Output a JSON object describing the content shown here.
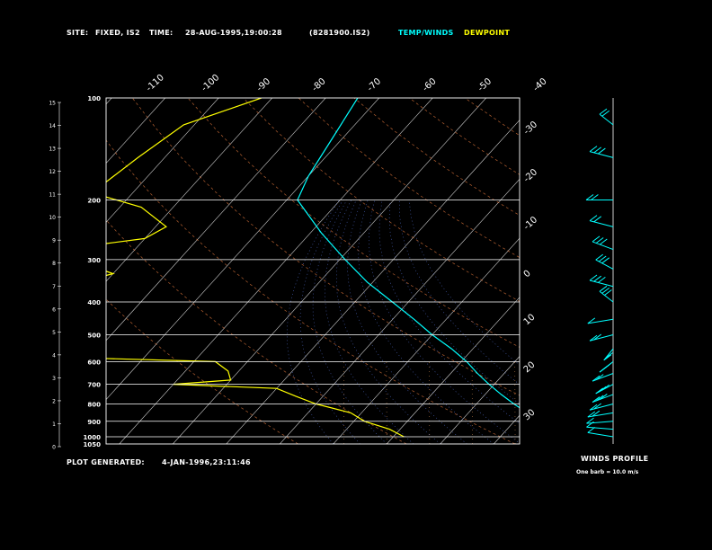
{
  "header": {
    "site_label": "SITE:",
    "site_value": "FIXED, IS2",
    "time_label": "TIME:",
    "time_value": "28-AUG-1995,19:00:28",
    "file_value": "(8281900.IS2)",
    "temp_legend": "TEMP/WINDS",
    "dew_legend": "DEWPOINT"
  },
  "footer": {
    "plot_generated_label": "PLOT GENERATED:",
    "plot_generated_value": "4-JAN-1996,23:11:46",
    "winds_profile_label": "WINDS PROFILE",
    "barb_note": "One barb = 10.0 m/s"
  },
  "colors": {
    "temperature": "#00ffff",
    "dewpoint": "#ffff00",
    "isobar": "#ffffff",
    "isotherm": "#ffffff",
    "dry_adiabat": "#ff8844",
    "moist_adiabat": "#6688ff",
    "mixing_ratio": "#ffaa66"
  },
  "chart_data": {
    "type": "line",
    "pressure_labels": [
      "100",
      "200",
      "300",
      "400",
      "500",
      "600",
      "700",
      "800",
      "900",
      "1000",
      "1050"
    ],
    "pressure_levels": [
      100,
      200,
      300,
      400,
      500,
      600,
      700,
      800,
      900,
      1000,
      1050
    ],
    "height_labels": [
      "15",
      "14",
      "13",
      "12",
      "11",
      "10",
      "9",
      "8",
      "7",
      "6",
      "5",
      "4",
      "3",
      "2",
      "1",
      "0"
    ],
    "top_temp_labels": [
      "-110",
      "-100",
      "-90",
      "-80",
      "-70",
      "-60",
      "-50",
      "-40"
    ],
    "right_temp_labels": [
      "-30",
      "-20",
      "-10",
      "0",
      "10",
      "20",
      "30"
    ],
    "series": [
      {
        "name": "TEMP/WINDS",
        "points": [
          {
            "p": 100,
            "t": -74
          },
          {
            "p": 130,
            "t": -72
          },
          {
            "p": 170,
            "t": -70
          },
          {
            "p": 200,
            "t": -68
          },
          {
            "p": 250,
            "t": -58
          },
          {
            "p": 300,
            "t": -49
          },
          {
            "p": 350,
            "t": -41
          },
          {
            "p": 400,
            "t": -33
          },
          {
            "p": 450,
            "t": -26
          },
          {
            "p": 500,
            "t": -20
          },
          {
            "p": 550,
            "t": -14
          },
          {
            "p": 600,
            "t": -9
          },
          {
            "p": 650,
            "t": -5
          },
          {
            "p": 700,
            "t": -1
          },
          {
            "p": 750,
            "t": 3
          },
          {
            "p": 800,
            "t": 7
          },
          {
            "p": 850,
            "t": 11
          },
          {
            "p": 900,
            "t": 15
          },
          {
            "p": 950,
            "t": 19
          },
          {
            "p": 1000,
            "t": 23
          }
        ]
      },
      {
        "name": "DEWPOINT",
        "points": [
          {
            "p": 100,
            "t": -92
          },
          {
            "p": 120,
            "t": -102
          },
          {
            "p": 150,
            "t": -105
          },
          {
            "p": 180,
            "t": -107
          },
          {
            "p": 190,
            "t": -108
          },
          {
            "p": 210,
            "t": -96
          },
          {
            "p": 240,
            "t": -88
          },
          {
            "p": 260,
            "t": -90
          },
          {
            "p": 280,
            "t": -104
          },
          {
            "p": 300,
            "t": -100
          },
          {
            "p": 330,
            "t": -90
          },
          {
            "p": 350,
            "t": -95
          },
          {
            "p": 380,
            "t": -96
          },
          {
            "p": 400,
            "t": -105
          },
          {
            "p": 430,
            "t": -115
          },
          {
            "p": 460,
            "t": -113
          },
          {
            "p": 480,
            "t": -110
          },
          {
            "p": 510,
            "t": -119
          },
          {
            "p": 540,
            "t": -110
          },
          {
            "p": 560,
            "t": -103
          },
          {
            "p": 580,
            "t": -90
          },
          {
            "p": 600,
            "t": -56
          },
          {
            "p": 640,
            "t": -52
          },
          {
            "p": 680,
            "t": -50
          },
          {
            "p": 700,
            "t": -60
          },
          {
            "p": 720,
            "t": -40
          },
          {
            "p": 760,
            "t": -35
          },
          {
            "p": 800,
            "t": -30
          },
          {
            "p": 850,
            "t": -22
          },
          {
            "p": 900,
            "t": -18
          },
          {
            "p": 950,
            "t": -12
          },
          {
            "p": 1000,
            "t": -8
          }
        ]
      }
    ],
    "winds": [
      {
        "p": 120,
        "dir": 330,
        "speed": 15
      },
      {
        "p": 150,
        "dir": 300,
        "speed": 25
      },
      {
        "p": 200,
        "dir": 270,
        "speed": 20
      },
      {
        "p": 240,
        "dir": 300,
        "speed": 15
      },
      {
        "p": 280,
        "dir": 310,
        "speed": 25
      },
      {
        "p": 320,
        "dir": 320,
        "speed": 30
      },
      {
        "p": 360,
        "dir": 300,
        "speed": 30
      },
      {
        "p": 400,
        "dir": 330,
        "speed": 25
      },
      {
        "p": 450,
        "dir": 250,
        "speed": 10
      },
      {
        "p": 500,
        "dir": 240,
        "speed": 15
      },
      {
        "p": 550,
        "dir": 200,
        "speed": 20
      },
      {
        "p": 600,
        "dir": 210,
        "speed": 25
      },
      {
        "p": 650,
        "dir": 230,
        "speed": 20
      },
      {
        "p": 700,
        "dir": 220,
        "speed": 25
      },
      {
        "p": 750,
        "dir": 230,
        "speed": 30
      },
      {
        "p": 800,
        "dir": 240,
        "speed": 20
      },
      {
        "p": 850,
        "dir": 250,
        "speed": 15
      },
      {
        "p": 900,
        "dir": 260,
        "speed": 10
      },
      {
        "p": 950,
        "dir": 280,
        "speed": 10
      },
      {
        "p": 1000,
        "dir": 290,
        "speed": 5
      }
    ]
  }
}
